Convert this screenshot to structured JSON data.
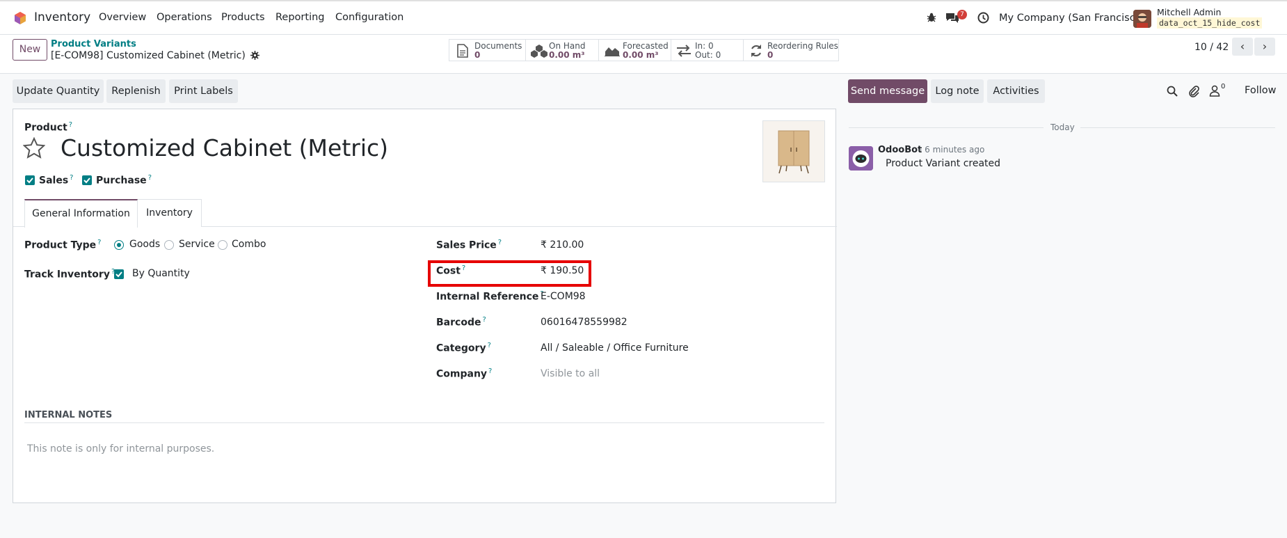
{
  "topbar": {
    "app_name": "Inventory",
    "menu": [
      "Overview",
      "Operations",
      "Products",
      "Reporting",
      "Configuration"
    ],
    "message_count": "7",
    "company": "My Company (San Francisco)",
    "user_name": "Mitchell Admin",
    "database": "data_oct_15_hide_cost"
  },
  "control": {
    "new_label": "New",
    "breadcrumb_parent": "Product Variants",
    "breadcrumb_current": "[E-COM98] Customized Cabinet (Metric)",
    "smart_buttons": [
      {
        "title": "Documents",
        "value": "0"
      },
      {
        "title": "On Hand",
        "value": "0.00 m³"
      },
      {
        "title": "Forecasted",
        "value": "0.00 m³"
      },
      {
        "title": "In: 0",
        "value": "Out: 0"
      },
      {
        "title": "Reordering Rules",
        "value": "0"
      }
    ],
    "pager": "10 / 42"
  },
  "actions": [
    "Update Quantity",
    "Replenish",
    "Print Labels"
  ],
  "form": {
    "product_label": "Product",
    "product_name": "Customized Cabinet (Metric)",
    "sales_label": "Sales",
    "purchase_label": "Purchase",
    "tabs": [
      "General Information",
      "Inventory"
    ],
    "product_type_label": "Product Type",
    "product_type_options": [
      "Goods",
      "Service",
      "Combo"
    ],
    "track_inventory_label": "Track Inventory",
    "track_inventory_value": "By Quantity",
    "fields": [
      {
        "label": "Sales Price",
        "value": "₹ 210.00"
      },
      {
        "label": "Cost",
        "value": "₹ 190.50"
      },
      {
        "label": "Internal Reference",
        "value": "E-COM98"
      },
      {
        "label": "Barcode",
        "value": "06016478559982"
      },
      {
        "label": "Category",
        "value": "All / Saleable / Office Furniture"
      },
      {
        "label": "Company",
        "value": "Visible to all"
      }
    ],
    "notes_title": "INTERNAL NOTES",
    "notes_placeholder": "This note is only for internal purposes."
  },
  "chatter": {
    "send_message": "Send message",
    "log_note": "Log note",
    "activities": "Activities",
    "follower_count": "0",
    "follow": "Follow",
    "today": "Today",
    "author": "OdooBot",
    "time": "- 6 minutes ago",
    "message": "Product Variant created"
  },
  "colors": {
    "primary": "#714b67",
    "teal": "#017e84",
    "highlight": "#e60000"
  }
}
